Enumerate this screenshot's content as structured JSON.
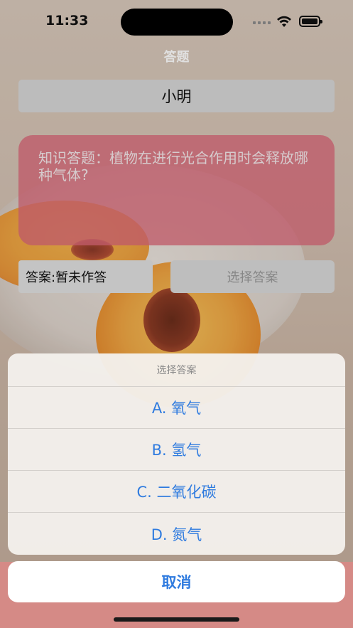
{
  "status": {
    "time": "11:33"
  },
  "nav": {
    "title": "答题"
  },
  "player": {
    "name": "小明"
  },
  "question": {
    "text": "知识答题：植物在进行光合作用时会释放哪种气体?"
  },
  "answer": {
    "label": "答案:暂未作答"
  },
  "choose_button": {
    "label": "选择答案"
  },
  "sheet": {
    "title": "选择答案",
    "options": [
      {
        "label": "A. 氧气"
      },
      {
        "label": "B. 氢气"
      },
      {
        "label": "C. 二氧化碳"
      },
      {
        "label": "D. 氮气"
      }
    ],
    "cancel_label": "取消"
  },
  "colors": {
    "accent": "#2f7bdf",
    "question_card": "#da6878",
    "cancel_tint": "#d58a86"
  }
}
